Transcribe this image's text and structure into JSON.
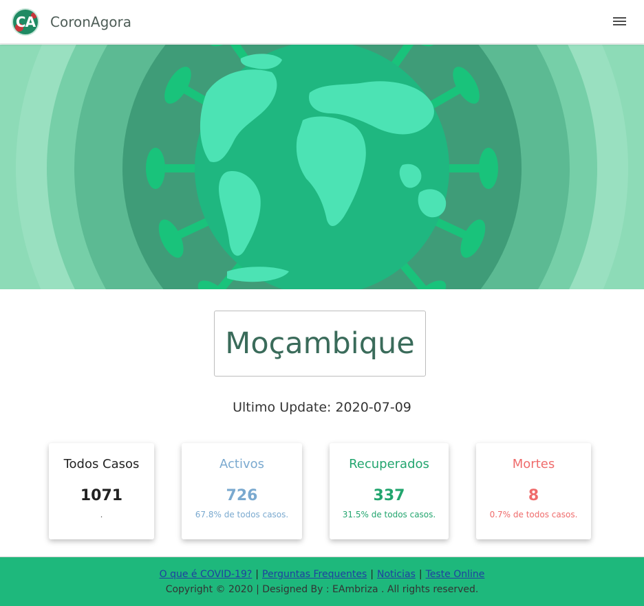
{
  "navbar": {
    "logo_text": "CA",
    "brand": "CoronAgora"
  },
  "hero": {
    "colors": {
      "outer": "#8ddbb7",
      "ring1": "#76cfa8",
      "ring2": "#5cba93",
      "ring3": "#3f9c78",
      "globe": "#1fb780",
      "land": "#4ce3b4",
      "spike": "#19c37b"
    }
  },
  "country": "Moçambique",
  "update": {
    "text": "Ultimo Update: 2020-07-09"
  },
  "stats": {
    "total": {
      "title": "Todos Casos",
      "value": "1071",
      "pct": "."
    },
    "active": {
      "title": "Activos",
      "value": "726",
      "pct": "67.8% de todos casos."
    },
    "recovered": {
      "title": "Recuperados",
      "value": "337",
      "pct": "31.5% de todos casos."
    },
    "deaths": {
      "title": "Mortes",
      "value": "8",
      "pct": "0.7% de todos casos."
    }
  },
  "footer": {
    "links": [
      "O que é COVID-19?",
      "Perguntas Frequentes",
      "Noticias",
      "Teste Online"
    ],
    "separator": "|",
    "copyright": "Copyright © 2020 | Designed By : EAmbriza . All rights reserved.",
    "color": "#1eb87c"
  }
}
